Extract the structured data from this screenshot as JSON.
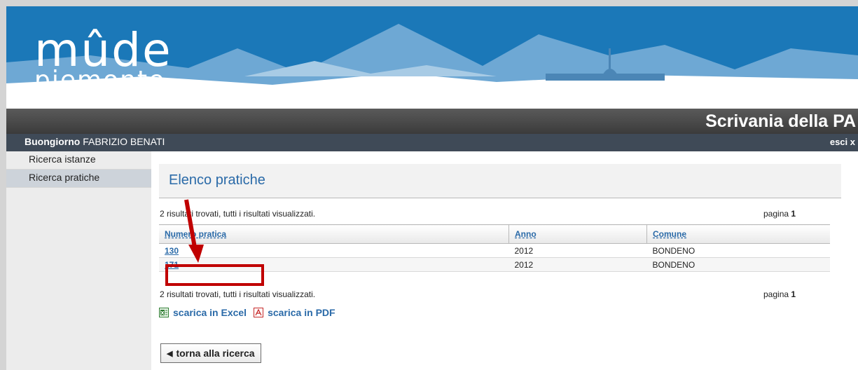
{
  "logo": {
    "line1": "mûde",
    "line2": "piemonte"
  },
  "header": {
    "app_title": "Scrivania della PA"
  },
  "userbar": {
    "greeting_prefix": "Buongiorno",
    "user_name": "FABRIZIO BENATI",
    "logout": "esci x"
  },
  "sidebar": {
    "items": [
      {
        "label": "Ricerca istanze"
      },
      {
        "label": "Ricerca pratiche"
      }
    ]
  },
  "main": {
    "title": "Elenco pratiche",
    "summary_top": "2 risultati trovati, tutti i risultati visualizzati.",
    "summary_bottom": "2 risultati trovati, tutti i risultati visualizzati.",
    "pagina_label": "pagina",
    "pagina_number": "1"
  },
  "table": {
    "headers": [
      "Numero pratica",
      "Anno",
      "Comune"
    ],
    "rows": [
      {
        "numero": "130",
        "anno": "2012",
        "comune": "BONDENO"
      },
      {
        "numero": "171",
        "anno": "2012",
        "comune": "BONDENO"
      }
    ]
  },
  "downloads": {
    "excel": "scarica in Excel",
    "pdf": "scarica in PDF",
    "excel_icon": "excel-icon",
    "pdf_icon": "pdf-icon"
  },
  "back_button": {
    "label": "torna alla ricerca",
    "icon": "triangle-left-icon"
  },
  "annotation": {
    "color": "#c00000"
  },
  "colors": {
    "link": "#2a6aa8",
    "banner_sky": "#1b78b8",
    "userbar": "#3f4a57"
  }
}
